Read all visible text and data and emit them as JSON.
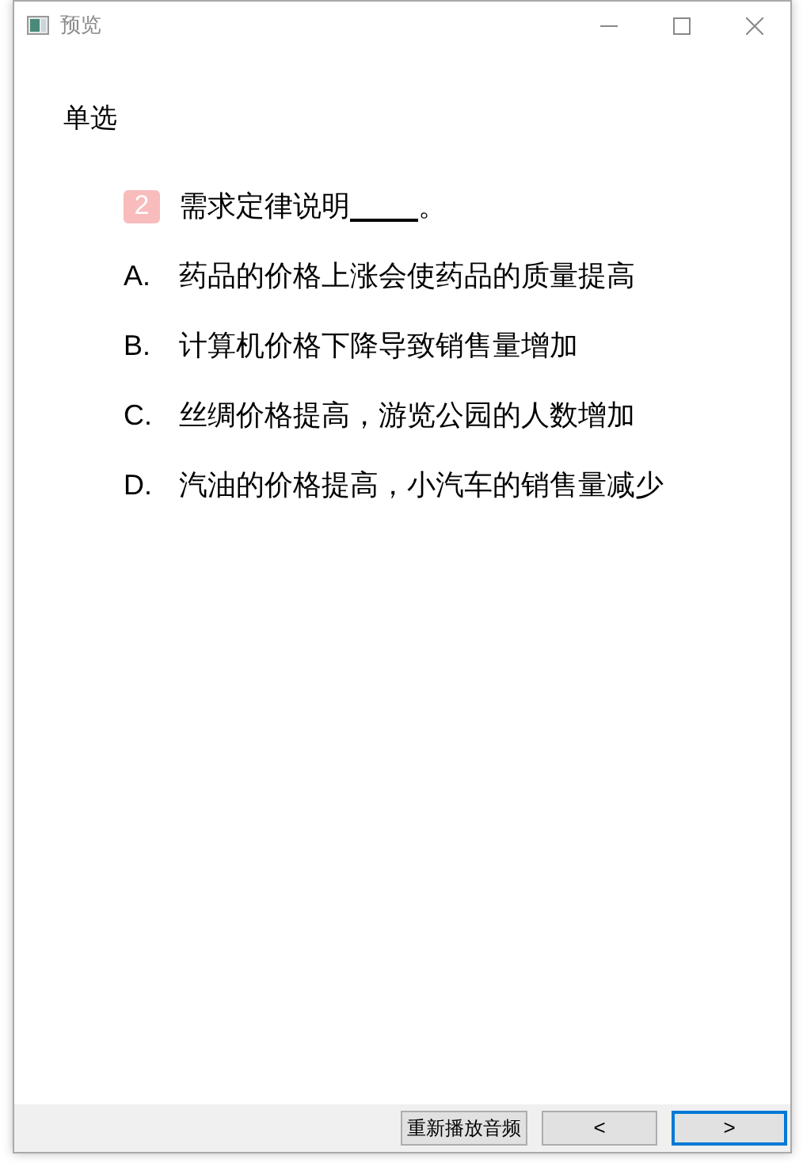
{
  "window": {
    "title": "预览"
  },
  "section_title": "单选",
  "question": {
    "number": "2",
    "stem": "需求定律说明",
    "stem_end": "。"
  },
  "options": [
    {
      "label": "A.",
      "text": "药品的价格上涨会使药品的质量提高"
    },
    {
      "label": "B.",
      "text": "计算机价格下降导致销售量增加"
    },
    {
      "label": "C.",
      "text": "丝绸价格提高，游览公园的人数增加"
    },
    {
      "label": "D.",
      "text": "汽油的价格提高，小汽车的销售量减少"
    }
  ],
  "footer": {
    "buttons": [
      {
        "kind": "text",
        "label": "重新播放音频",
        "focused": false
      },
      {
        "kind": "text",
        "label": "<",
        "focused": false
      },
      {
        "kind": "text",
        "label": ">",
        "focused": true
      }
    ]
  }
}
